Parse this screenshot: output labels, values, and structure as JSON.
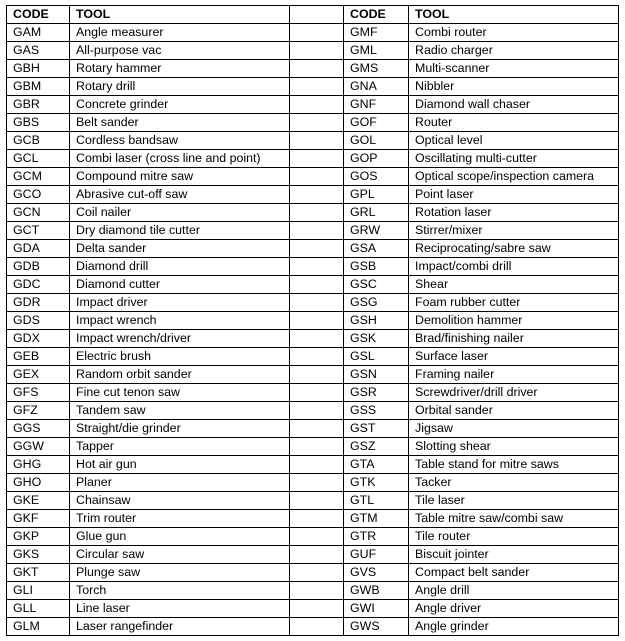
{
  "table": {
    "headers": {
      "code": "CODE",
      "tool": "TOOL"
    },
    "left_rows": [
      {
        "code": "GAM",
        "tool": "Angle measurer"
      },
      {
        "code": "GAS",
        "tool": "All-purpose  vac"
      },
      {
        "code": "GBH",
        "tool": "Rotary hammer"
      },
      {
        "code": "GBM",
        "tool": "Rotary drill"
      },
      {
        "code": "GBR",
        "tool": "Concrete grinder"
      },
      {
        "code": "GBS",
        "tool": "Belt sander"
      },
      {
        "code": "GCB",
        "tool": "Cordless bandsaw"
      },
      {
        "code": "GCL",
        "tool": "Combi laser (cross line  and point)"
      },
      {
        "code": "GCM",
        "tool": "Compound  mitre saw"
      },
      {
        "code": "GCO",
        "tool": "Abrasive cut-off saw"
      },
      {
        "code": "GCN",
        "tool": "Coil nailer"
      },
      {
        "code": "GCT",
        "tool": "Dry diamond  tile cutter"
      },
      {
        "code": "GDA",
        "tool": "Delta sander"
      },
      {
        "code": "GDB",
        "tool": "Diamond  drill"
      },
      {
        "code": "GDC",
        "tool": "Diamond  cutter"
      },
      {
        "code": "GDR",
        "tool": "Impact driver"
      },
      {
        "code": "GDS",
        "tool": "Impact wrench"
      },
      {
        "code": "GDX",
        "tool": "Impact wrench/driver"
      },
      {
        "code": "GEB",
        "tool": "Electric brush"
      },
      {
        "code": "GEX",
        "tool": "Random orbit  sander"
      },
      {
        "code": "GFS",
        "tool": "Fine  cut tenon saw"
      },
      {
        "code": "GFZ",
        "tool": "Tandem saw"
      },
      {
        "code": "GGS",
        "tool": "Straight/die grinder"
      },
      {
        "code": "GGW",
        "tool": "Tapper"
      },
      {
        "code": "GHG",
        "tool": "Hot air gun"
      },
      {
        "code": "GHO",
        "tool": "Planer"
      },
      {
        "code": "GKE",
        "tool": "Chainsaw"
      },
      {
        "code": "GKF",
        "tool": "Trim router"
      },
      {
        "code": "GKP",
        "tool": "Glue gun"
      },
      {
        "code": "GKS",
        "tool": "Circular saw"
      },
      {
        "code": "GKT",
        "tool": "Plunge saw"
      },
      {
        "code": "GLI",
        "tool": "Torch"
      },
      {
        "code": "GLL",
        "tool": "Line laser"
      },
      {
        "code": "GLM",
        "tool": "Laser rangefinder"
      }
    ],
    "right_rows": [
      {
        "code": "GMF",
        "tool": "Combi router"
      },
      {
        "code": "GML",
        "tool": "Radio charger"
      },
      {
        "code": "GMS",
        "tool": "Multi-scanner"
      },
      {
        "code": "GNA",
        "tool": "Nibbler"
      },
      {
        "code": "GNF",
        "tool": "Diamond  wall chaser"
      },
      {
        "code": "GOF",
        "tool": "Router"
      },
      {
        "code": "GOL",
        "tool": "Optical level"
      },
      {
        "code": "GOP",
        "tool": "Oscillating multi-cutter"
      },
      {
        "code": "GOS",
        "tool": "Optical scope/inspection  camera"
      },
      {
        "code": "GPL",
        "tool": "Point laser"
      },
      {
        "code": "GRL",
        "tool": "Rotation laser"
      },
      {
        "code": "GRW",
        "tool": "Stirrer/mixer"
      },
      {
        "code": "GSA",
        "tool": "Reciprocating/sabre saw"
      },
      {
        "code": "GSB",
        "tool": "Impact/combi  drill"
      },
      {
        "code": "GSC",
        "tool": "Shear"
      },
      {
        "code": "GSG",
        "tool": "Foam rubber cutter"
      },
      {
        "code": "GSH",
        "tool": "Demolition hammer"
      },
      {
        "code": "GSK",
        "tool": "Brad/finishing  nailer"
      },
      {
        "code": "GSL",
        "tool": "Surface laser"
      },
      {
        "code": "GSN",
        "tool": "Framing nailer"
      },
      {
        "code": "GSR",
        "tool": "Screwdriver/drill  driver"
      },
      {
        "code": "GSS",
        "tool": "Orbital sander"
      },
      {
        "code": "GST",
        "tool": "Jigsaw"
      },
      {
        "code": "GSZ",
        "tool": "Slotting shear"
      },
      {
        "code": "GTA",
        "tool": "Table stand for mitre saws"
      },
      {
        "code": "GTK",
        "tool": "Tacker"
      },
      {
        "code": "GTL",
        "tool": "Tile laser"
      },
      {
        "code": "GTM",
        "tool": "Table mitre saw/combi  saw"
      },
      {
        "code": "GTR",
        "tool": "Tile router"
      },
      {
        "code": "GUF",
        "tool": "Biscuit jointer"
      },
      {
        "code": "GVS",
        "tool": "Compact belt sander"
      },
      {
        "code": "GWB",
        "tool": "Angle drill"
      },
      {
        "code": "GWI",
        "tool": "Angle driver"
      },
      {
        "code": "GWS",
        "tool": "Angle grinder"
      }
    ]
  }
}
